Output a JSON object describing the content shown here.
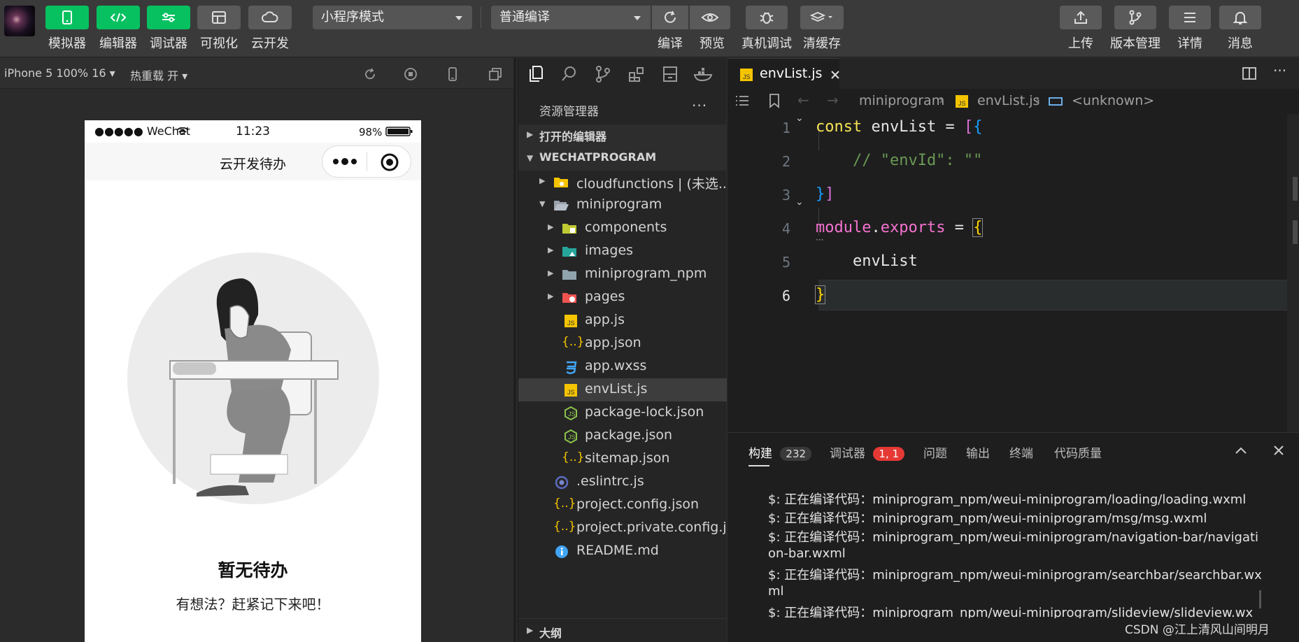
{
  "toolbar": {
    "buttons": [
      {
        "label": "模拟器",
        "icon": "phone-icon"
      },
      {
        "label": "编辑器",
        "icon": "code-icon"
      },
      {
        "label": "调试器",
        "icon": "sliders-icon"
      },
      {
        "label": "可视化",
        "icon": "layout-icon"
      },
      {
        "label": "云开发",
        "icon": "cloud-icon"
      }
    ],
    "mode_select": "小程序模式",
    "compile_select": "普通编译",
    "actions": [
      {
        "label": "编译",
        "icon": "refresh-icon"
      },
      {
        "label": "预览",
        "icon": "eye-icon"
      },
      {
        "label": "真机调试",
        "icon": "bug-icon"
      },
      {
        "label": "清缓存",
        "icon": "layers-icon"
      }
    ],
    "right_actions": [
      {
        "label": "上传",
        "icon": "upload-icon"
      },
      {
        "label": "版本管理",
        "icon": "branch-icon"
      },
      {
        "label": "详情",
        "icon": "menu-icon"
      },
      {
        "label": "消息",
        "icon": "bell-icon"
      }
    ]
  },
  "simulator": {
    "device": "iPhone 5 100% 16",
    "hot_reload": "热重载 开",
    "status_left": "●●●●● WeChat",
    "status_time": "11:23",
    "status_battery": "98%",
    "nav_title": "云开发待办",
    "empty_title": "暂无待办",
    "empty_sub": "有想法？赶紧记下来吧！"
  },
  "explorer": {
    "title": "资源管理器",
    "open_editors": "打开的编辑器",
    "project": "WECHATPROGRAM",
    "outline": "大纲",
    "items": [
      {
        "label": "cloudfunctions | (未选...",
        "icon": "folder-cloud-icon"
      },
      {
        "label": "miniprogram",
        "icon": "folder-open-icon"
      },
      {
        "label": "components",
        "icon": "folder-components-icon"
      },
      {
        "label": "images",
        "icon": "folder-images-icon"
      },
      {
        "label": "miniprogram_npm",
        "icon": "folder-icon"
      },
      {
        "label": "pages",
        "icon": "folder-pages-icon"
      },
      {
        "label": "app.js",
        "icon": "js-file-icon"
      },
      {
        "label": "app.json",
        "icon": "json-file-icon"
      },
      {
        "label": "app.wxss",
        "icon": "css-file-icon"
      },
      {
        "label": "envList.js",
        "icon": "js-file-icon"
      },
      {
        "label": "package-lock.json",
        "icon": "node-file-icon"
      },
      {
        "label": "package.json",
        "icon": "node-file-icon"
      },
      {
        "label": "sitemap.json",
        "icon": "json-file-icon"
      },
      {
        "label": ".eslintrc.js",
        "icon": "eslint-file-icon"
      },
      {
        "label": "project.config.json",
        "icon": "json-file-icon"
      },
      {
        "label": "project.private.config.js...",
        "icon": "json-file-icon"
      },
      {
        "label": "README.md",
        "icon": "info-file-icon"
      }
    ]
  },
  "editor": {
    "tab": "envList.js",
    "breadcrumb": [
      "miniprogram",
      "envList.js",
      "<unknown>"
    ],
    "lines": [
      "1",
      "2",
      "3",
      "4",
      "5",
      "6"
    ]
  },
  "panel": {
    "tabs": [
      "构建",
      "调试器",
      "问题",
      "输出",
      "终端",
      "代码质量"
    ],
    "build_count": "232",
    "debugger_badge": "1, 1",
    "logs": [
      "$: 正在编译代码：miniprogram_npm/weui-miniprogram/loading/loading.wxml",
      "$: 正在编译代码：miniprogram_npm/weui-miniprogram/msg/msg.wxml",
      "$: 正在编译代码：miniprogram_npm/weui-miniprogram/navigation-bar/navigati",
      "on-bar.wxml",
      "$: 正在编译代码：miniprogram_npm/weui-miniprogram/searchbar/searchbar.wx",
      "ml",
      "$: 正在编译代码：miniprogram_npm/weui-miniprogram/slideview/slideview.wx"
    ]
  },
  "watermark": "CSDN @江上清风山间明月"
}
